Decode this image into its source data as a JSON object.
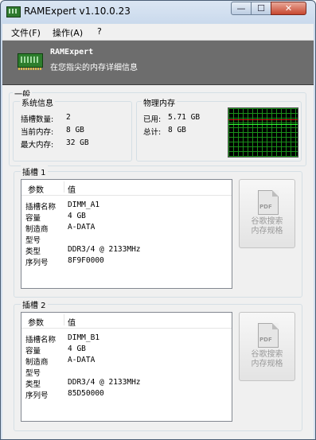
{
  "window": {
    "title": "RAMExpert v1.10.0.23",
    "min": "—",
    "max": "☐",
    "close": "✕"
  },
  "menu": {
    "file": "文件(F)",
    "action": "操作(A)",
    "help": "?"
  },
  "banner": {
    "title": "RAMExpert",
    "subtitle": "在您指尖的内存详细信息"
  },
  "general": {
    "label": "一般",
    "sysinfo": {
      "label": "系统信息",
      "rows": [
        {
          "k": "插槽数量:",
          "v": "2"
        },
        {
          "k": "当前内存:",
          "v": "8 GB"
        },
        {
          "k": "最大内存:",
          "v": "32 GB"
        }
      ]
    },
    "physmem": {
      "label": "物理内存",
      "rows": [
        {
          "k": "已用:",
          "v": "5.71 GB"
        },
        {
          "k": "总计:",
          "v": "8 GB"
        }
      ]
    }
  },
  "slots": [
    {
      "label": "插槽 1",
      "columns": [
        "参数",
        "值"
      ],
      "rows": [
        {
          "k": "插槽名称",
          "v": "DIMM_A1"
        },
        {
          "k": "容量",
          "v": "4 GB"
        },
        {
          "k": "制造商",
          "v": "A-DATA"
        },
        {
          "k": "型号",
          "v": ""
        },
        {
          "k": "类型",
          "v": "DDR3/4 @ 2133MHz"
        },
        {
          "k": "序列号",
          "v": "8F9F0000"
        }
      ],
      "button": {
        "icon": "PDF",
        "line1": "谷歌搜索",
        "line2": "内存规格"
      }
    },
    {
      "label": "插槽 2",
      "columns": [
        "参数",
        "值"
      ],
      "rows": [
        {
          "k": "插槽名称",
          "v": "DIMM_B1"
        },
        {
          "k": "容量",
          "v": "4 GB"
        },
        {
          "k": "制造商",
          "v": "A-DATA"
        },
        {
          "k": "型号",
          "v": ""
        },
        {
          "k": "类型",
          "v": "DDR3/4 @ 2133MHz"
        },
        {
          "k": "序列号",
          "v": "85D50000"
        }
      ],
      "button": {
        "icon": "PDF",
        "line1": "谷歌搜索",
        "line2": "内存规格"
      }
    }
  ],
  "colors": {
    "graph_bg": "#000000",
    "grid": "#1a8f1a",
    "used_line": "#d81818",
    "banner": "#6d6d6d"
  },
  "memory_graph": {
    "used_fraction": 0.71
  }
}
